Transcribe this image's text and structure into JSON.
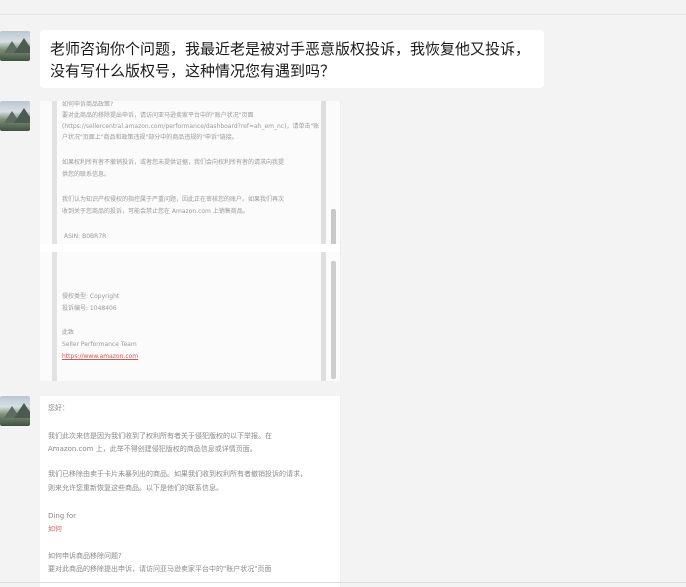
{
  "messages": {
    "first_text": "老师咨询你个问题，我最近老是被对手恶意版权投诉，我恢复他又投诉，没有写什么版权号，这种情况您有遇到吗？"
  },
  "image1": {
    "lines": [
      "如何申诉商品政策?",
      "要对此商品的移除提出申诉，请访问亚马逊卖家平台中的\"账户状况\"页面",
      "(https://sellercentral.amazon.com/performance/dashboard?ref=ah_em_nc)，请单击\"账",
      "户状况\"页面上\"商品和政策违规\"部分中的商品违规的\"申诉\"链接。",
      "如果权利所有者不撤销投诉，或者您未提供证据，我们会向权利所有者的请求向我提",
      "供您的联系信息。",
      "我们认为知识产权侵权的指控属于严重问题，因此正在审核您的账户。如果我们再次",
      "收到关于您商品的投诉，可能会禁止您在 Amazon.com 上销售商品。",
      "ASIN: B0BR7R",
      "侵权类型: Copyright",
      "投诉编号: 1048406",
      "此致",
      "Seller Performance Team",
      "https://www.amazon.com"
    ]
  },
  "image2": {
    "lines": [
      "您好：",
      "我们此次来信是因为我们收到了权利所有者关于侵犯版权的以下举报。在",
      "Amazon.com 上，此举不得创建侵犯版权的商品信息或详情页面。",
      "我们已移除由卖于卡片未暴列出的商品。如果我们收到权利所有者撤销投诉的请求，",
      "则来允许您重新恢复这些商品。以下是他们的联系信息。",
      "Ding for",
      "如何",
      "如何申诉商品移除问题?",
      "要对此商品的移除提出申诉，请访问亚马逊卖家平台中的\"账户状况\"页面"
    ]
  }
}
